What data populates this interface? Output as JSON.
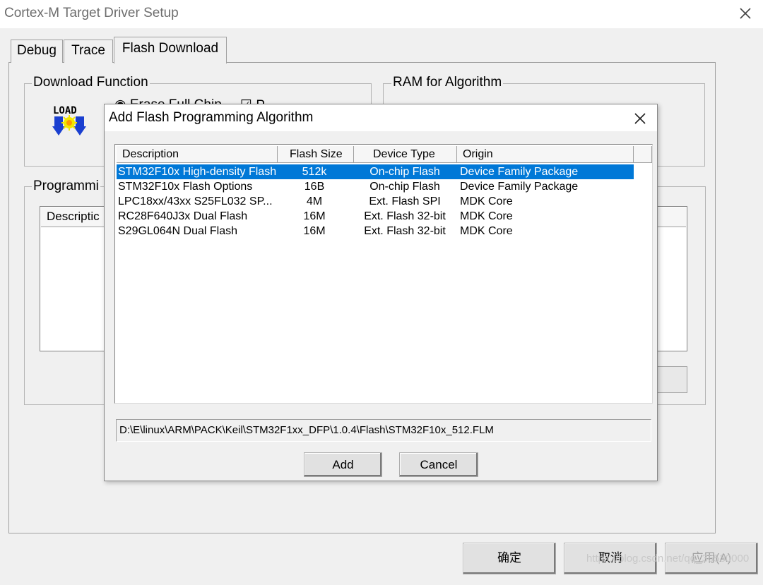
{
  "window": {
    "title": "Cortex-M Target Driver Setup"
  },
  "tabs": [
    {
      "label": "Debug"
    },
    {
      "label": "Trace"
    },
    {
      "label": "Flash Download"
    }
  ],
  "download_function": {
    "label": "Download Function",
    "load_icon_text": "LOAD",
    "erase_full_chip_label": "Erase Full Chip",
    "program_label": "P"
  },
  "ram_for_algorithm": {
    "label": "RAM for Algorithm"
  },
  "programming_algorithm": {
    "label": "Programmi",
    "description_header": "Descriptic"
  },
  "dialog": {
    "title": "Add Flash Programming Algorithm",
    "columns": [
      "Description",
      "Flash Size",
      "Device Type",
      "Origin"
    ],
    "rows": [
      {
        "description": "STM32F10x High-density Flash",
        "flash_size": "512k",
        "device_type": "On-chip Flash",
        "origin": "Device Family Package",
        "selected": true
      },
      {
        "description": "STM32F10x Flash Options",
        "flash_size": "16B",
        "device_type": "On-chip Flash",
        "origin": "Device Family Package",
        "selected": false
      },
      {
        "description": "LPC18xx/43xx S25FL032 SP...",
        "flash_size": "4M",
        "device_type": "Ext. Flash SPI",
        "origin": "MDK Core",
        "selected": false
      },
      {
        "description": "RC28F640J3x Dual Flash",
        "flash_size": "16M",
        "device_type": "Ext. Flash 32-bit",
        "origin": "MDK Core",
        "selected": false
      },
      {
        "description": "S29GL064N Dual Flash",
        "flash_size": "16M",
        "device_type": "Ext. Flash 32-bit",
        "origin": "MDK Core",
        "selected": false
      }
    ],
    "path": "D:\\E\\linux\\ARM\\PACK\\Keil\\STM32F1xx_DFP\\1.0.4\\Flash\\STM32F10x_512.FLM",
    "add_label": "Add",
    "cancel_label": "Cancel"
  },
  "footer": {
    "ok_label": "确定",
    "cancel_label": "取消",
    "apply_label": "应用(A)"
  },
  "watermark": "https://blog.csdn.net/qq_36530000",
  "icons": {
    "outer_close": "close-icon",
    "dialog_close": "close-icon",
    "load": "load-download-icon",
    "radio": "radio-button-icon",
    "checkbox": "checkbox-icon"
  },
  "colors": {
    "selection": "#0078d7",
    "window_bg": "#f0f0f0",
    "title_text": "#6d6d6d"
  }
}
